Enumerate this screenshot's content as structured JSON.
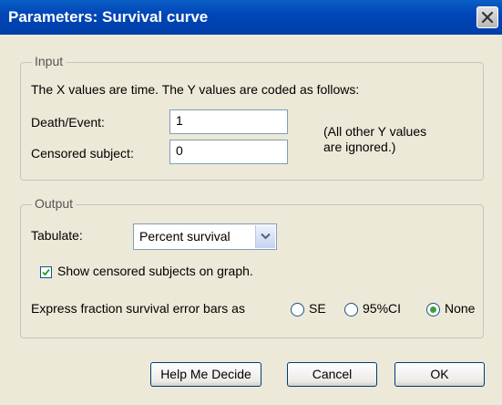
{
  "window": {
    "title": "Parameters: Survival curve",
    "close_icon": "close-icon"
  },
  "input_group": {
    "legend": "Input",
    "description": "The X values are time. The Y values are coded as follows:",
    "death_event_label": "Death/Event:",
    "death_event_value": "1",
    "censored_label": "Censored subject:",
    "censored_value": "0",
    "note_line1": "(All other Y values",
    "note_line2": "are ignored.)"
  },
  "output_group": {
    "legend": "Output",
    "tabulate_label": "Tabulate:",
    "tabulate_value": "Percent survival",
    "show_censored_label": "Show censored subjects on graph.",
    "show_censored_checked": true,
    "error_bars_label": "Express fraction survival error bars as",
    "error_bar_options": [
      {
        "label": "SE",
        "selected": false
      },
      {
        "label": "95%CI",
        "selected": false
      },
      {
        "label": "None",
        "selected": true
      }
    ]
  },
  "buttons": {
    "help": "Help Me Decide",
    "cancel": "Cancel",
    "ok": "OK"
  }
}
